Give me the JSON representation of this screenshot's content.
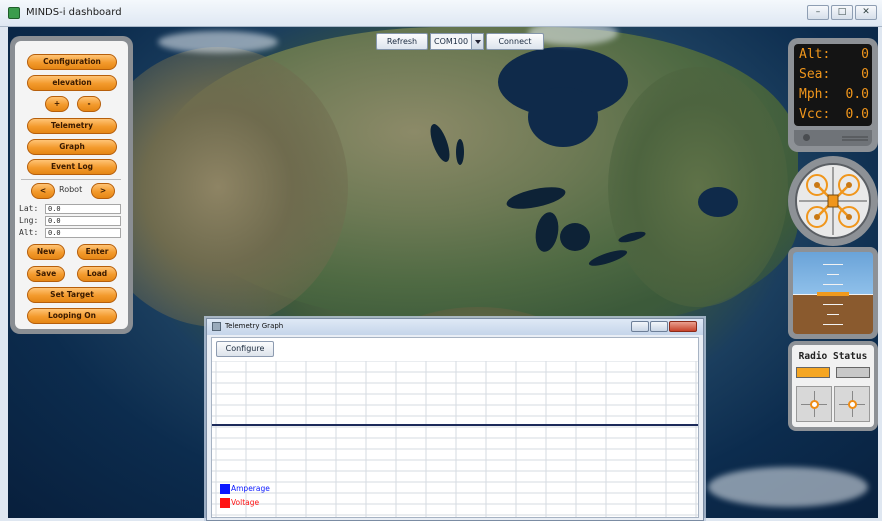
{
  "window": {
    "title": "MINDS-i dashboard",
    "controls": [
      "–",
      "□",
      "✕"
    ]
  },
  "toolbar": {
    "refresh_label": "Refresh",
    "port_value": "COM100",
    "connect_label": "Connect"
  },
  "left_panel": {
    "configuration_label": "Configuration",
    "elevation_label": "elevation",
    "plus_label": "+",
    "minus_label": "-",
    "telemetry_label": "Telemetry",
    "graph_label": "Graph",
    "event_log_label": "Event Log",
    "prev_label": "<",
    "robot_label": "Robot",
    "next_label": ">",
    "coords": [
      {
        "label": "Lat:",
        "value": "0.0"
      },
      {
        "label": "Lng:",
        "value": "0.0"
      },
      {
        "label": "Alt:",
        "value": "0.0"
      }
    ],
    "new_label": "New",
    "enter_label": "Enter",
    "save_label": "Save",
    "load_label": "Load",
    "set_target_label": "Set Target",
    "looping_label": "Looping On"
  },
  "instruments": {
    "readouts": [
      {
        "label": "Alt:",
        "value": "0"
      },
      {
        "label": "Sea:",
        "value": "0"
      },
      {
        "label": "Mph:",
        "value": "0.0"
      },
      {
        "label": "Vcc:",
        "value": "0.0"
      }
    ],
    "radio_title": "Radio Status",
    "radio_left_color": "#f5a623",
    "radio_right_color": "#c8c8c8",
    "accent_color": "#f0961c"
  },
  "telemetry_graph": {
    "title": "Telemetry Graph",
    "configure_label": "Configure",
    "legend": [
      {
        "name": "Amperage",
        "color": "#0b18ff"
      },
      {
        "name": "Voltage",
        "color": "#ff1414"
      }
    ]
  }
}
